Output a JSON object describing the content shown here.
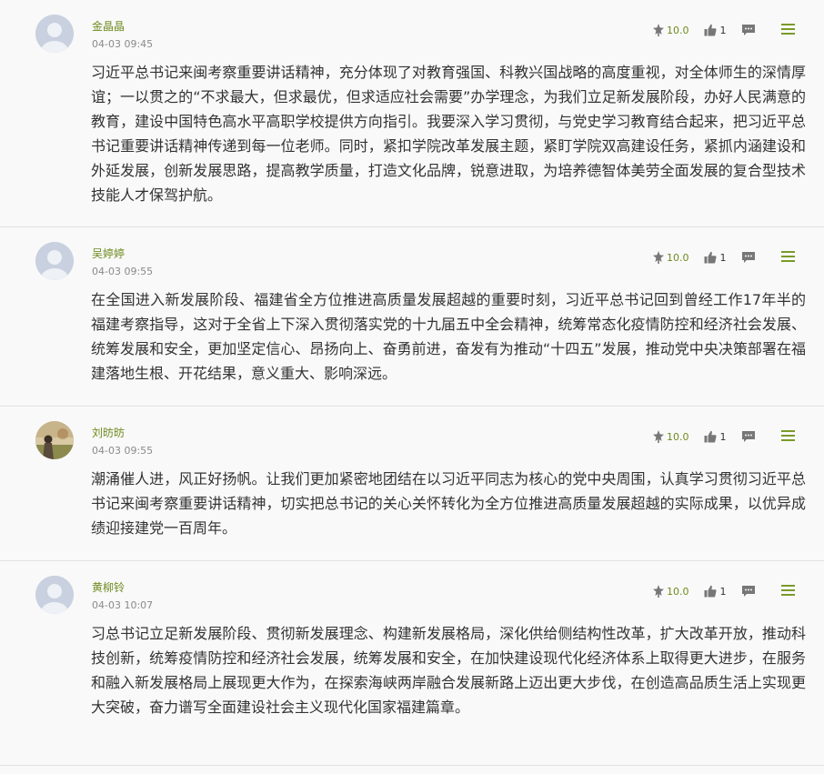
{
  "comments": [
    {
      "name": "金晶晶",
      "time": "04-03 09:45",
      "score": "10.0",
      "likes": "1",
      "avatar": "default-avatar",
      "text": "习近平总书记来闽考察重要讲话精神，充分体现了对教育强国、科教兴国战略的高度重视，对全体师生的深情厚谊；一以贯之的“不求最大，但求最优，但求适应社会需要”办学理念，为我们立足新发展阶段，办好人民满意的教育，建设中国特色高水平高职学校提供方向指引。我要深入学习贯彻，与党史学习教育结合起来，把习近平总书记重要讲话精神传递到每一位老师。同时，紧扣学院改革发展主题，紧盯学院双高建设任务，紧抓内涵建设和外延发展，创新发展思路，提高教学质量，打造文化品牌，锐意进取，为培养德智体美劳全面发展的复合型技术技能人才保驾护航。"
    },
    {
      "name": "吴婷婷",
      "time": "04-03 09:55",
      "score": "10.0",
      "likes": "1",
      "avatar": "default-avatar",
      "text": "在全国进入新发展阶段、福建省全方位推进高质量发展超越的重要时刻，习近平总书记回到曾经工作17年半的福建考察指导，这对于全省上下深入贯彻落实党的十九届五中全会精神，统筹常态化疫情防控和经济社会发展、统筹发展和安全，更加坚定信心、昂扬向上、奋勇前进，奋发有为推动“十四五”发展，推动党中央决策部署在福建落地生根、开花结果，意义重大、影响深远。"
    },
    {
      "name": "刘昉昉",
      "time": "04-03 09:55",
      "score": "10.0",
      "likes": "1",
      "avatar": "photo-avatar",
      "text": "潮涌催人进，风正好扬帆。让我们更加紧密地团结在以习近平同志为核心的党中央周围，认真学习贯彻习近平总书记来闽考察重要讲话精神，切实把总书记的关心关怀转化为全方位推进高质量发展超越的实际成果，以优异成绩迎接建党一百周年。"
    },
    {
      "name": "黄柳铃",
      "time": "04-03 10:07",
      "score": "10.0",
      "likes": "1",
      "avatar": "default-avatar",
      "text": "习总书记立足新发展阶段、贯彻新发展理念、构建新发展格局，深化供给侧结构性改革，扩大改革开放，推动科技创新，统筹疫情防控和经济社会发展，统筹发展和安全，在加快建设现代化经济体系上取得更大进步，在服务和融入新发展格局上展现更大作为，在探索海峡两岸融合发展新路上迈出更大步伐，在创造高品质生活上实现更大突破，奋力谱写全面建设社会主义现代化国家福建篇章。"
    }
  ]
}
